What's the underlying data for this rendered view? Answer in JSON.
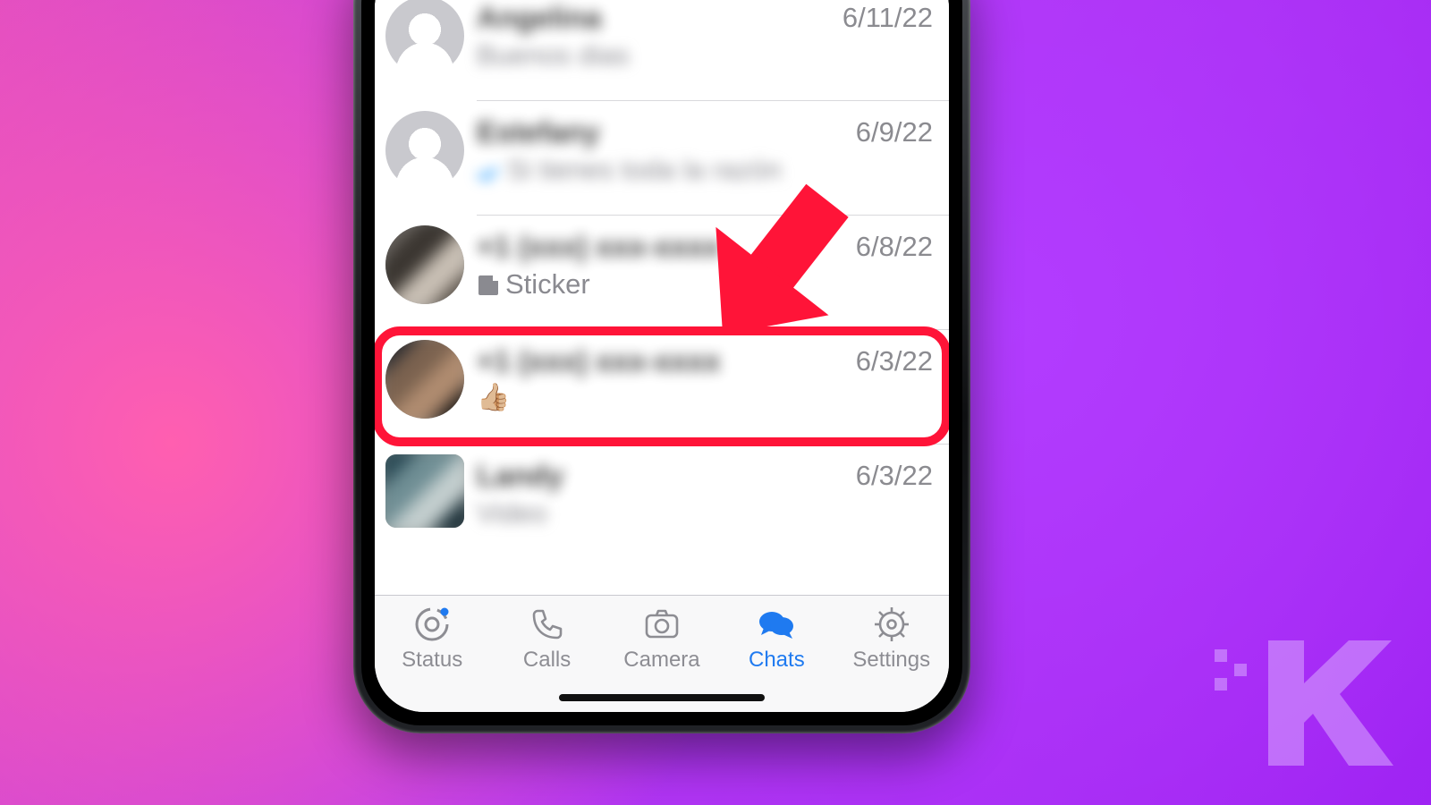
{
  "chats": [
    {
      "name": "Angelina",
      "snippet": "Buenos dias",
      "date": "6/11/22",
      "avatar": "default"
    },
    {
      "name": "Estefany",
      "snippet": "Si tienes toda la razón",
      "date": "6/9/22",
      "avatar": "default",
      "read": true
    },
    {
      "name": "+1 (xxx) xxx-xxxx",
      "snippet": "Sticker",
      "date": "6/8/22",
      "avatar": "pix",
      "sticker": true
    },
    {
      "name": "+1 (xxx) xxx-xxxx",
      "snippet": "👍🏼",
      "date": "6/3/22",
      "avatar": "pix2",
      "highlight": true,
      "emoji": true
    },
    {
      "name": "Landy",
      "snippet": "Video",
      "date": "6/3/22",
      "avatar": "pix3"
    }
  ],
  "tabs": {
    "status": "Status",
    "calls": "Calls",
    "camera": "Camera",
    "chats": "Chats",
    "settings": "Settings"
  }
}
